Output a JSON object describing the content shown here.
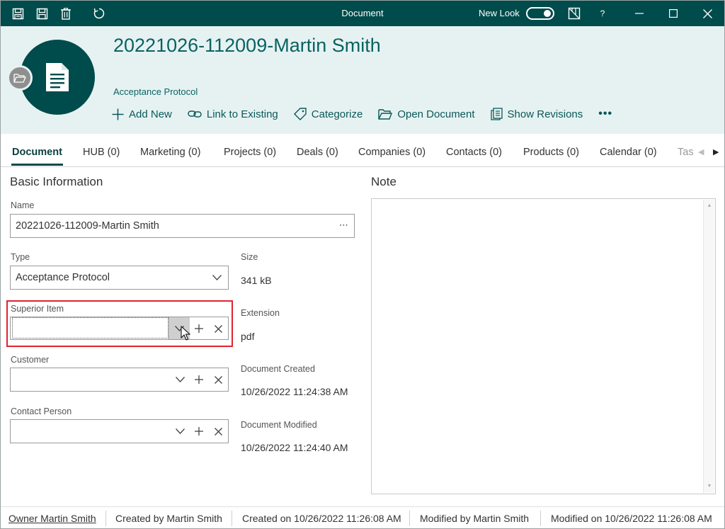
{
  "titlebar": {
    "title": "Document",
    "new_look_label": "New Look",
    "help_label": "?"
  },
  "header": {
    "doc_title": "20221026-112009-Martin Smith",
    "doc_type": "Acceptance Protocol",
    "actions": [
      {
        "label": "Add New",
        "icon": "plus-icon"
      },
      {
        "label": "Link to Existing",
        "icon": "link-icon"
      },
      {
        "label": "Categorize",
        "icon": "tag-icon"
      },
      {
        "label": "Open Document",
        "icon": "folder-open-icon"
      },
      {
        "label": "Show Revisions",
        "icon": "revisions-icon"
      }
    ],
    "more_label": "•••"
  },
  "tabs": [
    {
      "label": "Document"
    },
    {
      "label": "HUB (0)"
    },
    {
      "label": "Marketing (0)"
    },
    {
      "label": "Projects (0)"
    },
    {
      "label": "Deals (0)"
    },
    {
      "label": "Companies (0)"
    },
    {
      "label": "Contacts (0)"
    },
    {
      "label": "Products (0)"
    },
    {
      "label": "Calendar (0)"
    },
    {
      "label": "Tas"
    }
  ],
  "basic": {
    "section_title": "Basic Information",
    "name_label": "Name",
    "name_value": "20221026-112009-Martin Smith",
    "type_label": "Type",
    "type_value": "Acceptance Protocol",
    "superior_label": "Superior Item",
    "superior_value": "",
    "customer_label": "Customer",
    "customer_value": "",
    "contact_label": "Contact Person",
    "contact_value": "",
    "size_label": "Size",
    "size_value": "341 kB",
    "ext_label": "Extension",
    "ext_value": "pdf",
    "created_label": "Document Created",
    "created_value": "10/26/2022 11:24:38 AM",
    "modified_label": "Document Modified",
    "modified_value": "10/26/2022 11:24:40 AM"
  },
  "note": {
    "section_title": "Note",
    "value": ""
  },
  "footer": {
    "owner": "Owner Martin Smith",
    "created_by": "Created by Martin Smith",
    "created_on": "Created on 10/26/2022 11:26:08 AM",
    "modified_by": "Modified by Martin Smith",
    "modified_on": "Modified on 10/26/2022 11:26:08 AM"
  },
  "colors": {
    "brand": "#004b4b",
    "header_bg": "#e6f2f2",
    "highlight": "#e0242e"
  }
}
